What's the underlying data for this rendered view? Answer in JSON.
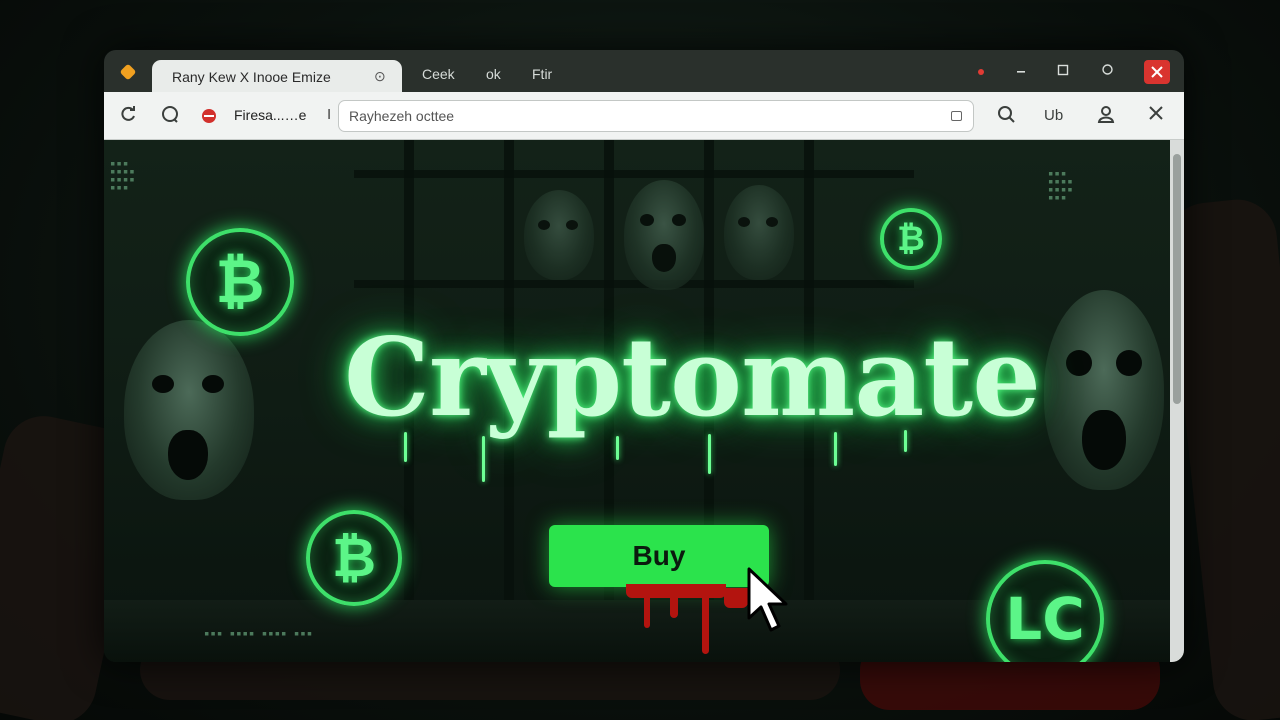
{
  "window": {
    "active_tab_title": "Rany Kew X Inooe Emize",
    "tab_close_glyph": "⊙",
    "other_tabs": [
      "Ceek",
      "ok",
      "Ftir"
    ]
  },
  "toolbar": {
    "site_label": "Firesa...…e",
    "separator": "I",
    "address_value": "Rayhezeh octtee",
    "right_text": "Ub"
  },
  "hero": {
    "title": "Cryptomate",
    "buy_label": "Buy",
    "coin_symbol": "₿",
    "alt_coin_label": "LC"
  },
  "decor": {
    "pixel_text": "▪▪▪ ▪▪▪▪ ▪▪▪▪ ▪▪▪"
  },
  "colors": {
    "accent_green": "#2be34c",
    "glow_green": "#3ee06a",
    "blood_red": "#b3140f",
    "close_red": "#d9342f"
  },
  "icons": {
    "app": "app-diamond-icon",
    "tab_close": "tab-close-icon",
    "back": "back-icon",
    "home": "home-icon",
    "site": "site-favicon-icon",
    "lock": "lock-icon",
    "search": "search-icon",
    "profile": "profile-icon",
    "close": "close-icon",
    "minimize": "minimize-icon",
    "maximize": "maximize-icon",
    "restore": "restore-icon",
    "window_close": "window-close-icon",
    "bitcoin": "bitcoin-icon",
    "litecoin": "litecoin-icon",
    "cursor": "mouse-cursor-icon"
  }
}
